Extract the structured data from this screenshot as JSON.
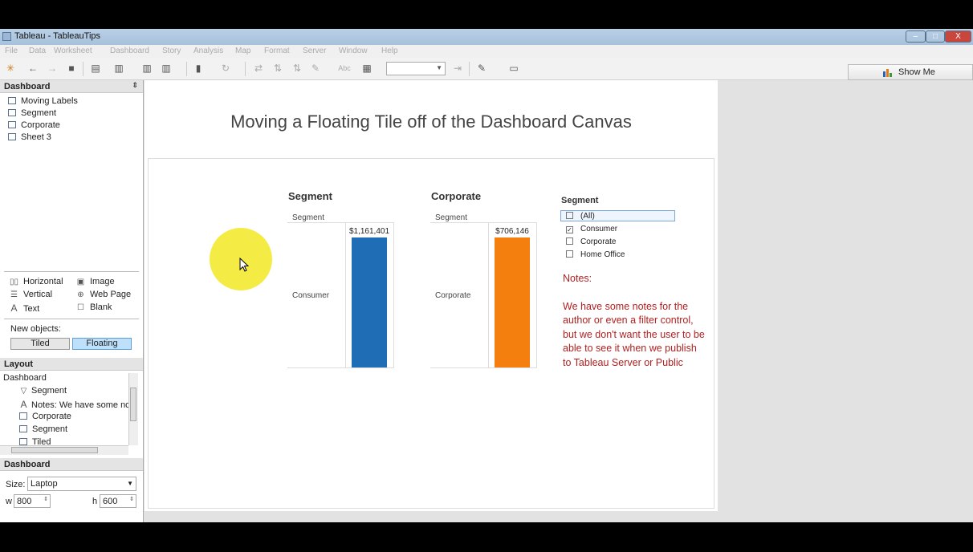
{
  "window": {
    "title": "Tableau - TableauTips",
    "controls": [
      "–",
      "□",
      "X"
    ]
  },
  "menu": [
    "File",
    "Data",
    "Worksheet",
    "Dashboard",
    "Story",
    "Analysis",
    "Map",
    "Format",
    "Server",
    "Window",
    "Help"
  ],
  "toolbar": {
    "show_me": "Show Me"
  },
  "sidebar": {
    "dashboard_header": "Dashboard",
    "sheets": [
      "Moving Labels",
      "Segment",
      "Corporate",
      "Sheet 3"
    ],
    "objects": {
      "horizontal": "Horizontal",
      "image": "Image",
      "vertical": "Vertical",
      "web_page": "Web Page",
      "text": "Text",
      "blank": "Blank"
    },
    "new_objects_label": "New objects:",
    "tiled": "Tiled",
    "floating": "Floating",
    "layout_header": "Layout",
    "layout_items": [
      "Dashboard",
      "Segment",
      "Notes:  We have some no",
      "Corporate",
      "Segment",
      "Tiled"
    ],
    "size_header": "Dashboard",
    "size_label": "Size:",
    "size_value": "Laptop",
    "w_label": "w",
    "w_value": "800",
    "h_label": "h",
    "h_value": "600"
  },
  "dashboard": {
    "title": "Moving a Floating Tile off of the Dashboard Canvas",
    "segment_sheet_title": "Segment",
    "corporate_sheet_title": "Corporate",
    "filter": {
      "title": "Segment",
      "options": [
        {
          "label": "(All)",
          "checked": false
        },
        {
          "label": "Consumer",
          "checked": true
        },
        {
          "label": "Corporate",
          "checked": false
        },
        {
          "label": "Home Office",
          "checked": false
        }
      ]
    },
    "notes": {
      "heading": "Notes:",
      "body": "We have some notes for the author or even a filter control, but we don't want the user to be able to see it when we publish to Tableau Server or Public"
    }
  },
  "chart_data": [
    {
      "type": "bar",
      "title": "Segment",
      "xlabel": "Segment",
      "categories": [
        "Consumer"
      ],
      "values": [
        1161401
      ],
      "data_labels": [
        "$1,161,401"
      ],
      "color": "#1f6db4"
    },
    {
      "type": "bar",
      "title": "Corporate",
      "xlabel": "Segment",
      "categories": [
        "Corporate"
      ],
      "values": [
        706146
      ],
      "data_labels": [
        "$706,146"
      ],
      "color": "#f57f0e"
    }
  ],
  "icons": {
    "app": "tableau-app-icon",
    "cursor": "mouse-cursor-icon"
  }
}
